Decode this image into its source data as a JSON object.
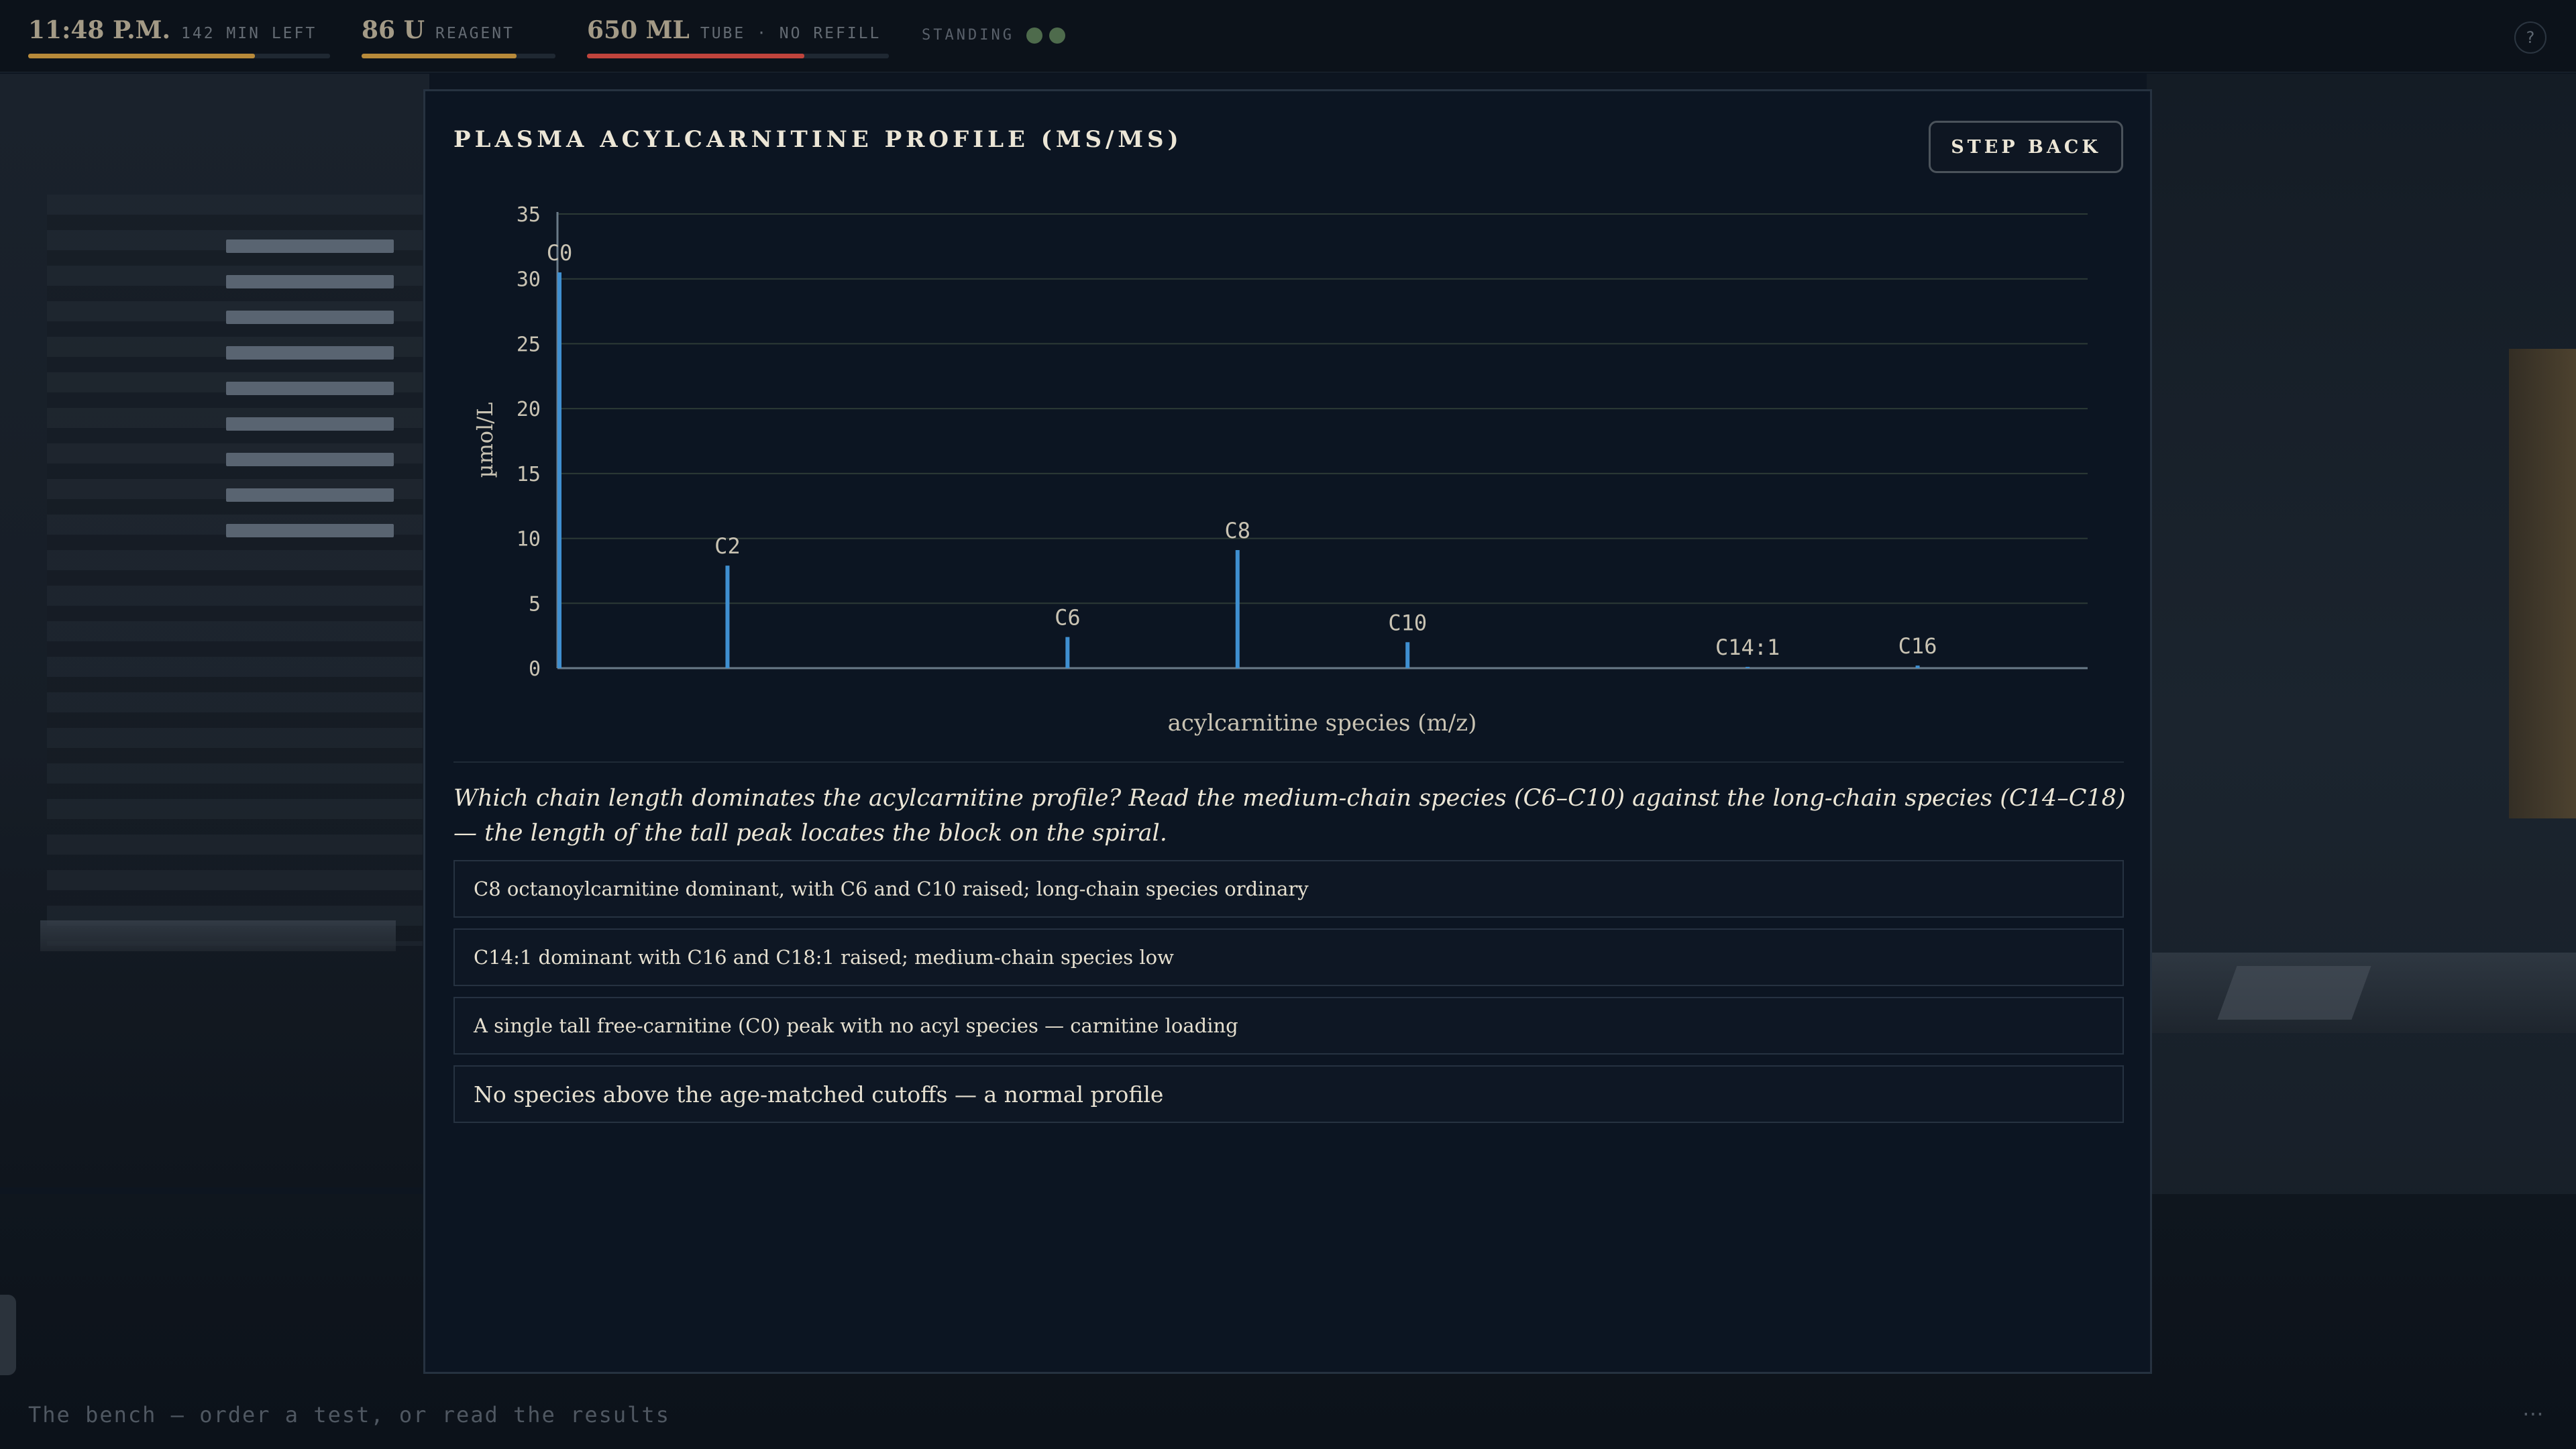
{
  "hud": {
    "time": {
      "value": "11:48 P.M.",
      "label": "142 MIN LEFT",
      "progress": 0.75,
      "color": "#b88a3a"
    },
    "reagent": {
      "value": "86 U",
      "label": "REAGENT",
      "progress": 0.8,
      "color": "#b88a3a"
    },
    "tube": {
      "value": "650 ML",
      "label": "TUBE · NO REFILL",
      "progress": 0.72,
      "color": "#c0443c"
    },
    "standing": {
      "label": "STANDING",
      "dots": 2,
      "dot_color": "#4e6b4c"
    },
    "help_label": "?"
  },
  "modal": {
    "title": "PLASMA ACYLCARNITINE PROFILE (MS/MS)",
    "step_back_label": "STEP BACK",
    "question": "Which chain length dominates the acylcarnitine profile? Read the medium-chain species (C6–C10) against the long-chain species (C14–C18) — the length of the tall peak locates the block on the spiral.",
    "options": [
      {
        "label": "C8 octanoylcarnitine dominant, with C6 and C10 raised; long-chain species ordinary"
      },
      {
        "label": "C14:1 dominant with C16 and C18:1 raised; medium-chain species low"
      },
      {
        "label": "A single tall free-carnitine (C0) peak with no acyl species — carnitine loading"
      },
      {
        "label": "No species above the age-matched cutoffs — a normal profile"
      }
    ]
  },
  "chart_data": {
    "type": "bar",
    "title": "",
    "xlabel": "acylcarnitine species (m/z)",
    "ylabel": "µmol/L",
    "ylim": [
      0,
      35
    ],
    "yticks": [
      0,
      5,
      10,
      15,
      20,
      25,
      30,
      35
    ],
    "grid": true,
    "bar_color": "#3f8fd0",
    "categories": [
      "C0",
      "C2",
      "C6",
      "C8",
      "C10",
      "C14:1",
      "C16"
    ],
    "values": [
      30.5,
      7.9,
      2.4,
      9.1,
      2.0,
      0.1,
      0.2
    ]
  },
  "footer": {
    "status": "The bench — order a test, or read the results",
    "more_label": "⋯"
  }
}
